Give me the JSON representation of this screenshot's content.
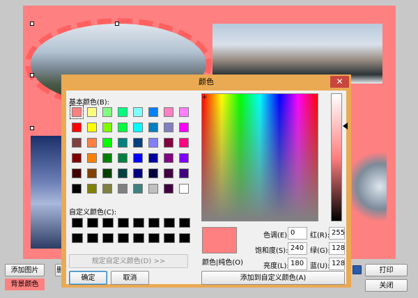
{
  "app": {
    "buttons": {
      "add_image": "添加图片",
      "partial_button": "删",
      "print": "打印",
      "close": "关闭"
    },
    "bg_color_label": "背景颜色",
    "canvas_color": "#ff8080"
  },
  "dialog": {
    "title": "颜色",
    "close_icon": "close-icon",
    "basic_colors_label": "基本颜色(B):",
    "basic_colors": [
      "#ff8080",
      "#ffff80",
      "#80ff80",
      "#00ff80",
      "#80ffff",
      "#0080ff",
      "#ff80c0",
      "#ff80ff",
      "#ff0000",
      "#ffff00",
      "#80ff00",
      "#00ff40",
      "#00ffff",
      "#0080c0",
      "#8080c0",
      "#ff00ff",
      "#804040",
      "#ff8040",
      "#00ff00",
      "#008080",
      "#004080",
      "#8080ff",
      "#800040",
      "#ff0080",
      "#800000",
      "#ff8000",
      "#008000",
      "#008040",
      "#0000ff",
      "#0000a0",
      "#800080",
      "#8000ff",
      "#400000",
      "#804000",
      "#004000",
      "#004040",
      "#000080",
      "#000040",
      "#400040",
      "#400080",
      "#000000",
      "#808000",
      "#808040",
      "#808080",
      "#408080",
      "#c0c0c0",
      "#400040",
      "#ffffff"
    ],
    "selected_basic_index": 0,
    "custom_colors_label": "自定义颜色(C):",
    "custom_colors": [
      "#000000",
      "#000000",
      "#000000",
      "#000000",
      "#000000",
      "#000000",
      "#000000",
      "#000000",
      "#000000",
      "#000000",
      "#000000",
      "#000000",
      "#000000",
      "#000000",
      "#000000",
      "#000000"
    ],
    "define_custom_button": "规定自定义颜色(D) >>",
    "ok_button": "确定",
    "cancel_button": "取消",
    "color_solid_label": "颜色|纯色(O)",
    "add_custom_button": "添加到自定义颜色(A)",
    "fields": {
      "hue_label": "色调(E):",
      "hue_value": "0",
      "sat_label": "饱和度(S):",
      "sat_value": "240",
      "lum_label": "亮度(L):",
      "lum_value": "180",
      "red_label": "红(R):",
      "red_value": "255",
      "green_label": "绿(G):",
      "green_value": "128",
      "blue_label": "蓝(U):",
      "blue_value": "128"
    },
    "preview_color": "#ff8080"
  }
}
